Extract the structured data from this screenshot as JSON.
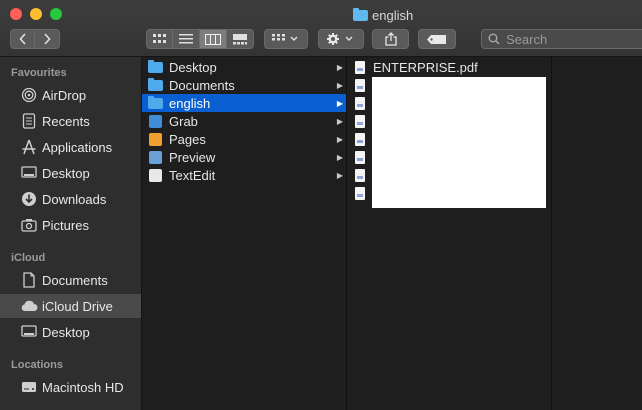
{
  "window": {
    "title": "english"
  },
  "toolbar": {
    "back_icon": "chevron-left",
    "forward_icon": "chevron-right",
    "views": [
      "icon-view",
      "list-view",
      "column-view",
      "gallery-view"
    ],
    "selected_view": "column-view",
    "group_icon": "grid-dropdown",
    "action_icon": "gear-dropdown",
    "share_icon": "share",
    "tag_icon": "tag",
    "search_placeholder": "Search"
  },
  "sidebar": {
    "favourites_title": "Favourites",
    "favourites": [
      {
        "label": "AirDrop",
        "icon": "airdrop-icon"
      },
      {
        "label": "Recents",
        "icon": "recents-icon"
      },
      {
        "label": "Applications",
        "icon": "applications-icon"
      },
      {
        "label": "Desktop",
        "icon": "desktop-icon"
      },
      {
        "label": "Downloads",
        "icon": "downloads-icon"
      },
      {
        "label": "Pictures",
        "icon": "pictures-icon"
      }
    ],
    "icloud_title": "iCloud",
    "icloud": [
      {
        "label": "Documents",
        "icon": "document-icon"
      },
      {
        "label": "iCloud Drive",
        "icon": "cloud-icon",
        "active": true
      },
      {
        "label": "Desktop",
        "icon": "desktop-icon"
      }
    ],
    "locations_title": "Locations",
    "locations": [
      {
        "label": "Macintosh HD",
        "icon": "harddrive-icon"
      }
    ]
  },
  "column1": [
    {
      "label": "Desktop",
      "kind": "folder"
    },
    {
      "label": "Documents",
      "kind": "folder"
    },
    {
      "label": "english",
      "kind": "folder",
      "selected": true
    },
    {
      "label": "Grab",
      "kind": "app",
      "color": "#3f8fd8"
    },
    {
      "label": "Pages",
      "kind": "app",
      "color": "#f0a030"
    },
    {
      "label": "Preview",
      "kind": "app",
      "color": "#6aa0d8"
    },
    {
      "label": "TextEdit",
      "kind": "app",
      "color": "#e8e8e8"
    }
  ],
  "column2": [
    {
      "label": "ENTERPRISE.pdf",
      "kind": "pdf"
    },
    {
      "label": "",
      "kind": "pdf"
    },
    {
      "label": "",
      "kind": "pdf"
    },
    {
      "label": "",
      "kind": "pdf"
    },
    {
      "label": "",
      "kind": "pdf"
    },
    {
      "label": "",
      "kind": "pdf"
    },
    {
      "label": "",
      "kind": "pdf"
    },
    {
      "label": "",
      "kind": "pdf"
    }
  ],
  "colors": {
    "accent": "#0a5fd0",
    "folder": "#4eaaea"
  }
}
